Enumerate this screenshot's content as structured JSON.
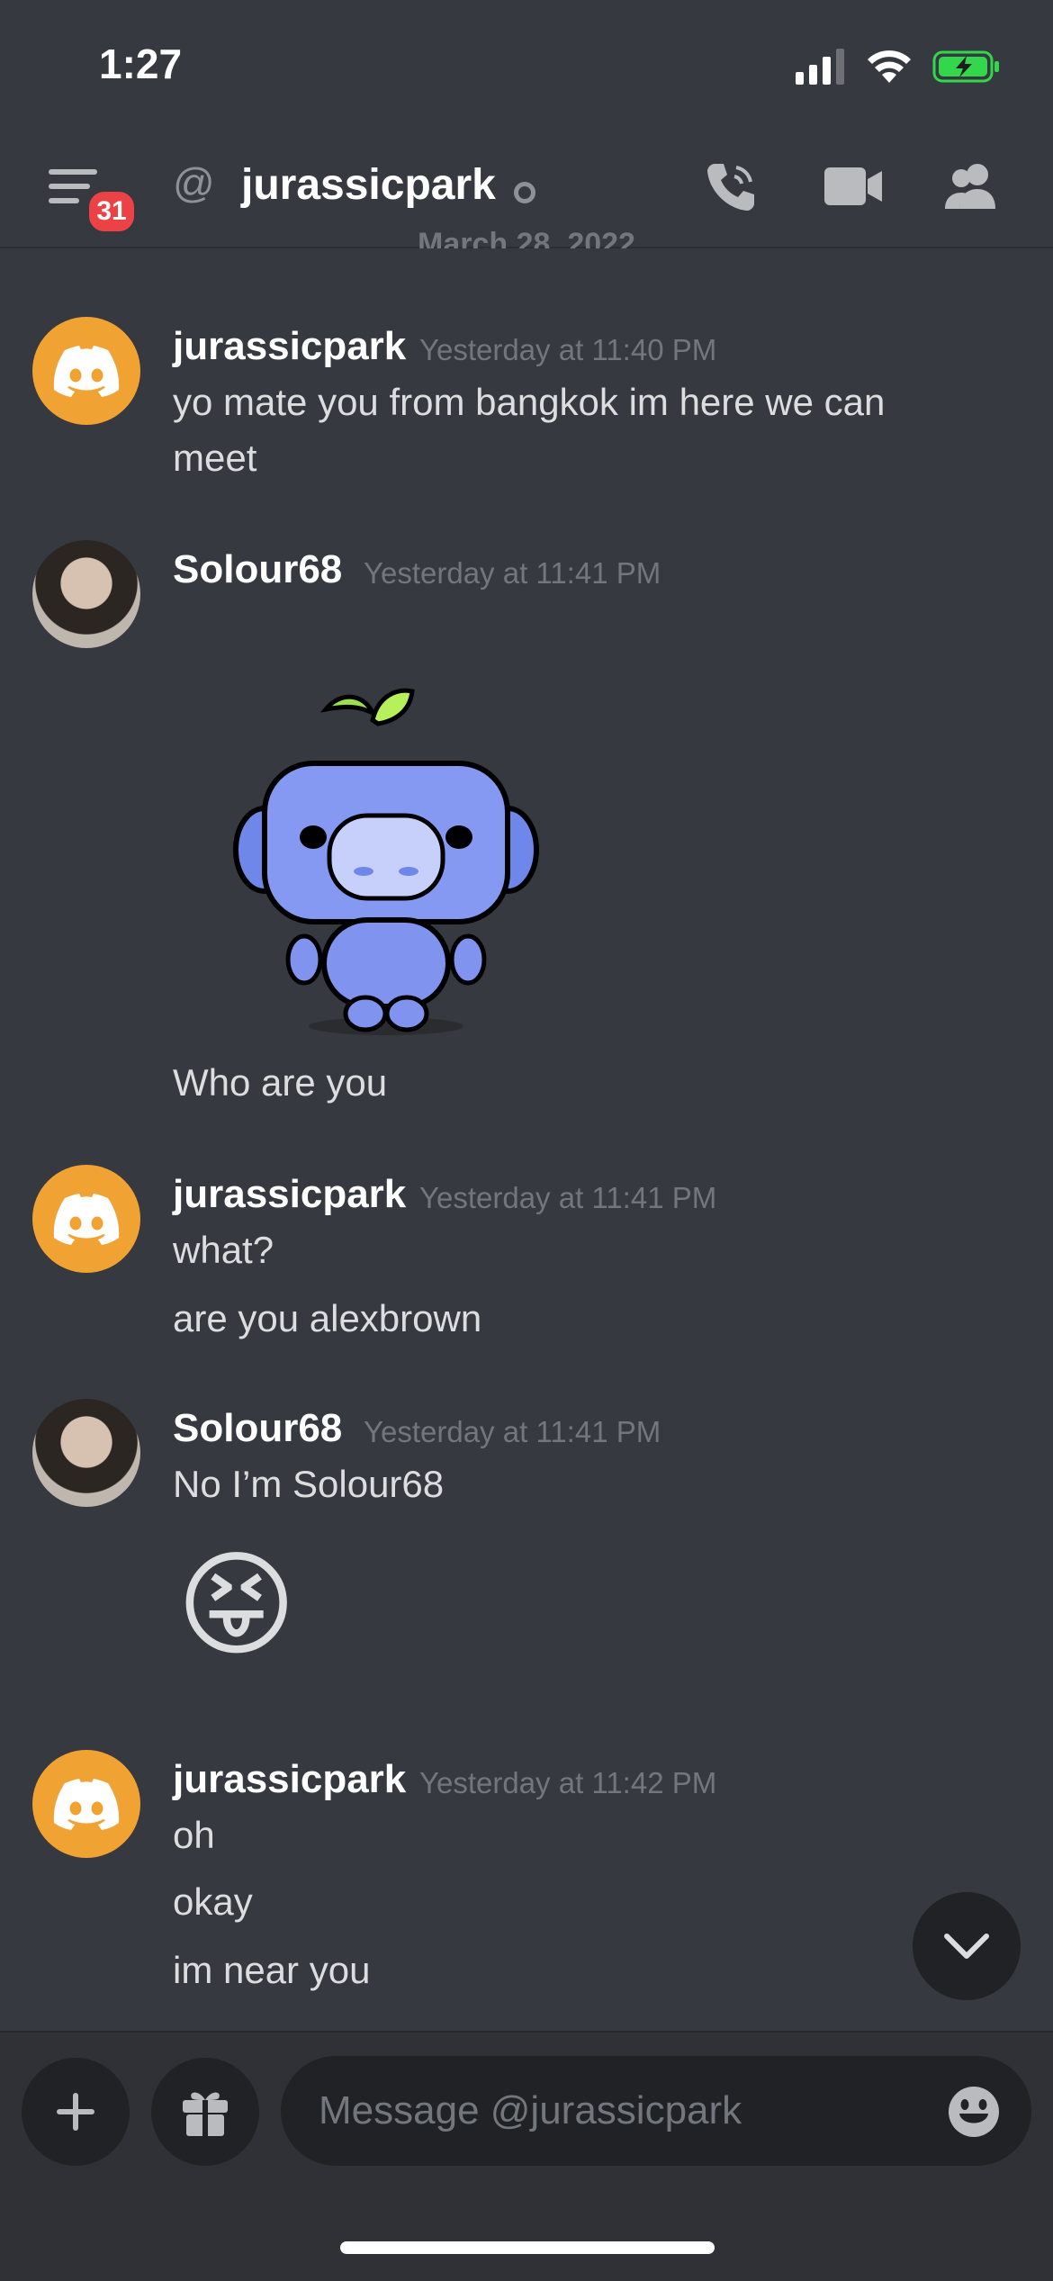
{
  "status_bar": {
    "time": "1:27"
  },
  "header": {
    "badge_count": "31",
    "channel_name": "jurassicpark"
  },
  "date_divider": "March 28, 2022",
  "messages": [
    {
      "author": "jurassicpark",
      "time": "Yesterday at 11:40 PM",
      "lines": [
        "yo mate you from bangkok im here we can",
        "meet"
      ]
    },
    {
      "author": "Solour68",
      "time": "Yesterday at 11:41 PM",
      "sticker": "wumpus-sticker",
      "lines": [
        "Who are you"
      ]
    },
    {
      "author": "jurassicpark",
      "time": "Yesterday at 11:41 PM",
      "lines": [
        "what?",
        "are you alexbrown"
      ]
    },
    {
      "author": "Solour68",
      "time": "Yesterday at 11:41 PM",
      "lines": [
        "No I’m Solour68"
      ],
      "emoji": "😝"
    },
    {
      "author": "jurassicpark",
      "time": "Yesterday at 11:42 PM",
      "lines": [
        "oh",
        "okay",
        "im near you"
      ]
    }
  ],
  "composer": {
    "placeholder": "Message @jurassicpark"
  },
  "colors": {
    "discord_orange": "#f0a232",
    "badge_red": "#ed4245",
    "battery_green": "#32d74b"
  }
}
